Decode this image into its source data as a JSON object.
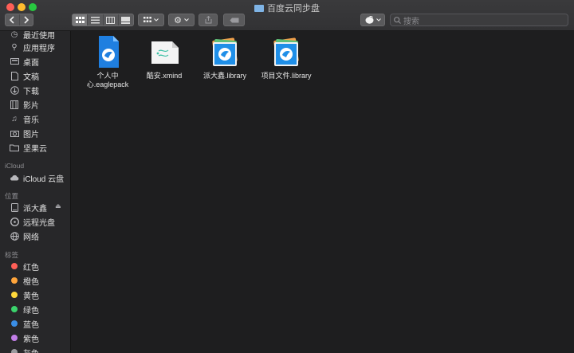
{
  "window": {
    "title": "百度云同步盘"
  },
  "toolbar": {
    "back_icon": "chevron-left-icon",
    "forward_icon": "chevron-right-icon",
    "search_placeholder": "搜索"
  },
  "sidebar": {
    "items_top": [
      {
        "label": "最近使用",
        "icon": "clock-icon"
      },
      {
        "label": "应用程序",
        "icon": "applications-icon"
      },
      {
        "label": "桌面",
        "icon": "desktop-icon"
      },
      {
        "label": "文稿",
        "icon": "document-icon"
      },
      {
        "label": "下载",
        "icon": "download-icon"
      },
      {
        "label": "影片",
        "icon": "film-icon"
      },
      {
        "label": "音乐",
        "icon": "music-icon"
      },
      {
        "label": "图片",
        "icon": "camera-icon"
      },
      {
        "label": "坚果云",
        "icon": "folder-icon"
      }
    ],
    "icloud_header": "iCloud",
    "icloud_item": "iCloud 云盘",
    "locations_header": "位置",
    "locations": [
      {
        "label": "派大鑫",
        "icon": "drive-icon"
      },
      {
        "label": "远程光盘",
        "icon": "disc-icon"
      },
      {
        "label": "网络",
        "icon": "globe-icon"
      }
    ],
    "tags_header": "标签",
    "tags": [
      {
        "label": "红色",
        "color": "#ff5f57"
      },
      {
        "label": "橙色",
        "color": "#ffa53b"
      },
      {
        "label": "黄色",
        "color": "#ffd93b"
      },
      {
        "label": "绿色",
        "color": "#3bd36c"
      },
      {
        "label": "蓝色",
        "color": "#3a8ee6"
      },
      {
        "label": "紫色",
        "color": "#c27ee8"
      },
      {
        "label": "灰色",
        "color": "#9a9a9e"
      }
    ]
  },
  "files": [
    {
      "label": "个人中心.eaglepack",
      "line1": "个人中",
      "line2": "心.eaglepack",
      "icon": "eaglepack-file-icon"
    },
    {
      "label": "酷安.xmind",
      "icon": "xmind-file-icon"
    },
    {
      "label": "派大鑫.library",
      "icon": "library-file-icon"
    },
    {
      "label": "项目文件.library",
      "icon": "library-file-icon"
    }
  ]
}
